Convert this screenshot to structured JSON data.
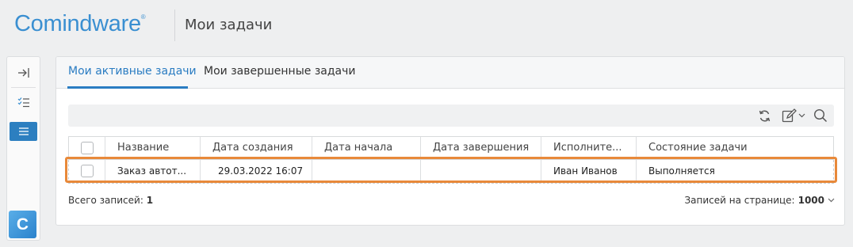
{
  "header": {
    "logo_text": "Comindware",
    "logo_reg": "®",
    "page_title": "Мои задачи"
  },
  "tabs": [
    {
      "label": "Мои активные задачи",
      "active": true
    },
    {
      "label": "Мои завершенные задачи",
      "active": false
    }
  ],
  "sidebar": {
    "items": [
      {
        "icon": "expand-panel-icon"
      },
      {
        "icon": "task-list-icon"
      },
      {
        "icon": "menu-icon",
        "active": true
      }
    ],
    "app_logo_letter": "C"
  },
  "toolbar": {
    "icons": [
      "refresh-icon",
      "edit-icon",
      "chevron-down-icon",
      "search-icon"
    ]
  },
  "table": {
    "columns": [
      "Название",
      "Дата создания",
      "Дата начала",
      "Дата завершения",
      "Исполните...",
      "Состояние задачи"
    ],
    "rows": [
      [
        "Заказ автот...",
        "29.03.2022 16:07",
        "",
        "",
        "Иван Иванов",
        "Выполняется"
      ]
    ]
  },
  "footer": {
    "total_label": "Всего записей:",
    "total_value": "1",
    "per_page_label": "Записей на странице:",
    "per_page_value": "1000"
  },
  "colors": {
    "accent": "#2a7cc2",
    "highlight": "#e8893a"
  }
}
